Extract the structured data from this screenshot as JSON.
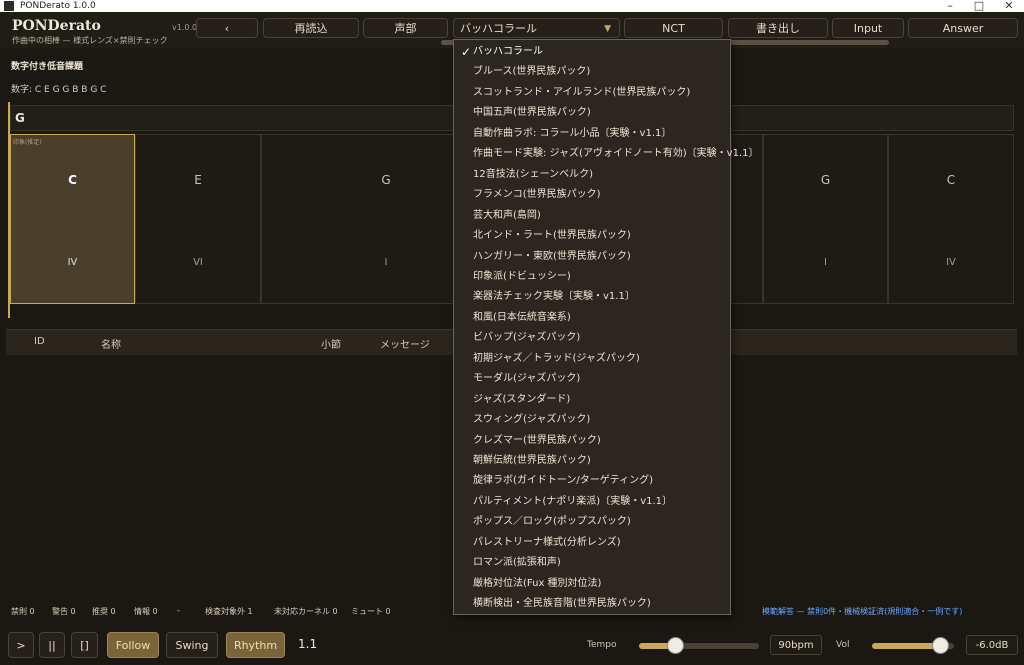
{
  "window": {
    "title": "PONDerato 1.0.0"
  },
  "app": {
    "brand": "PONDerato",
    "subtitle": "作曲中の相棒 — 様式レンズ×禁則チェック",
    "version": "v1.0.0"
  },
  "toolbar": {
    "back_label": "‹",
    "reload_label": "再読込",
    "voices_label": "声部",
    "style_selected": "バッハコラール",
    "nct_label": "NCT",
    "export_label": "書き出し",
    "input_label": "Input",
    "answer_label": "Answer"
  },
  "main": {
    "section_title": "数字付き低音課題",
    "digits": "数字: C E G G B B G C",
    "key": "G",
    "active_tag": "印象(推定)",
    "chords": [
      {
        "chord": "C",
        "roman": "IV"
      },
      {
        "chord": "E",
        "roman": "VI"
      },
      {
        "chord": "G",
        "roman": "I"
      },
      {
        "chord": "G",
        "roman": "I"
      },
      {
        "chord": "C",
        "roman": "IV"
      }
    ]
  },
  "table": {
    "headers": [
      "ID",
      "名称",
      "小節",
      "メッセージ"
    ]
  },
  "stats": {
    "forbidden": "禁則 0",
    "warning": "警告 0",
    "recommend": "推奨 0",
    "info": "情報 0",
    "dash": "-",
    "out_of_scope": "検査対象外 1",
    "unsupported": "未対応カーネル 0",
    "mute": "ミュート 0",
    "legal_note": "模範解答 — 禁則0件・機械検証済(規則適合・一例です)"
  },
  "transport": {
    "play": ">",
    "pause": "||",
    "stop": "[]",
    "follow": "Follow",
    "swing": "Swing",
    "rhythm": "Rhythm",
    "position": "1.1",
    "tempo_label": "Tempo",
    "tempo_value": "90bpm",
    "tempo_level": 0.3,
    "vol_label": "Vol",
    "vol_value": "-6.0dB",
    "vol_level": 0.83
  },
  "dropdown": {
    "options": [
      "バッハコラール",
      "ブルース(世界民族パック)",
      "スコットランド・アイルランド(世界民族パック)",
      "中国五声(世界民族パック)",
      "自動作曲ラボ: コラール小品〔実験・v1.1〕",
      "作曲モード実験: ジャズ(アヴォイドノート有効)〔実験・v1.1〕",
      "12音技法(シェーンベルク)",
      "フラメンコ(世界民族パック)",
      "芸大和声(島岡)",
      "北インド・ラート(世界民族パック)",
      "ハンガリー・東欧(世界民族パック)",
      "印象派(ドビュッシー)",
      "楽器法チェック実験〔実験・v1.1〕",
      "和風(日本伝統音楽系)",
      "ビバップ(ジャズパック)",
      "初期ジャズ／トラッド(ジャズパック)",
      "モーダル(ジャズパック)",
      "ジャズ(スタンダード)",
      "スウィング(ジャズパック)",
      "クレズマー(世界民族パック)",
      "朝鮮伝統(世界民族パック)",
      "旋律ラボ(ガイドトーン/ターゲティング)",
      "パルティメント(ナポリ楽派)〔実験・v1.1〕",
      "ポップス／ロック(ポップスパック)",
      "パレストリーナ様式(分析レンズ)",
      "ロマン派(拡張和声)",
      "厳格対位法(Fux 種別対位法)",
      "横断検出・全民族音階(世界民族パック)"
    ]
  }
}
